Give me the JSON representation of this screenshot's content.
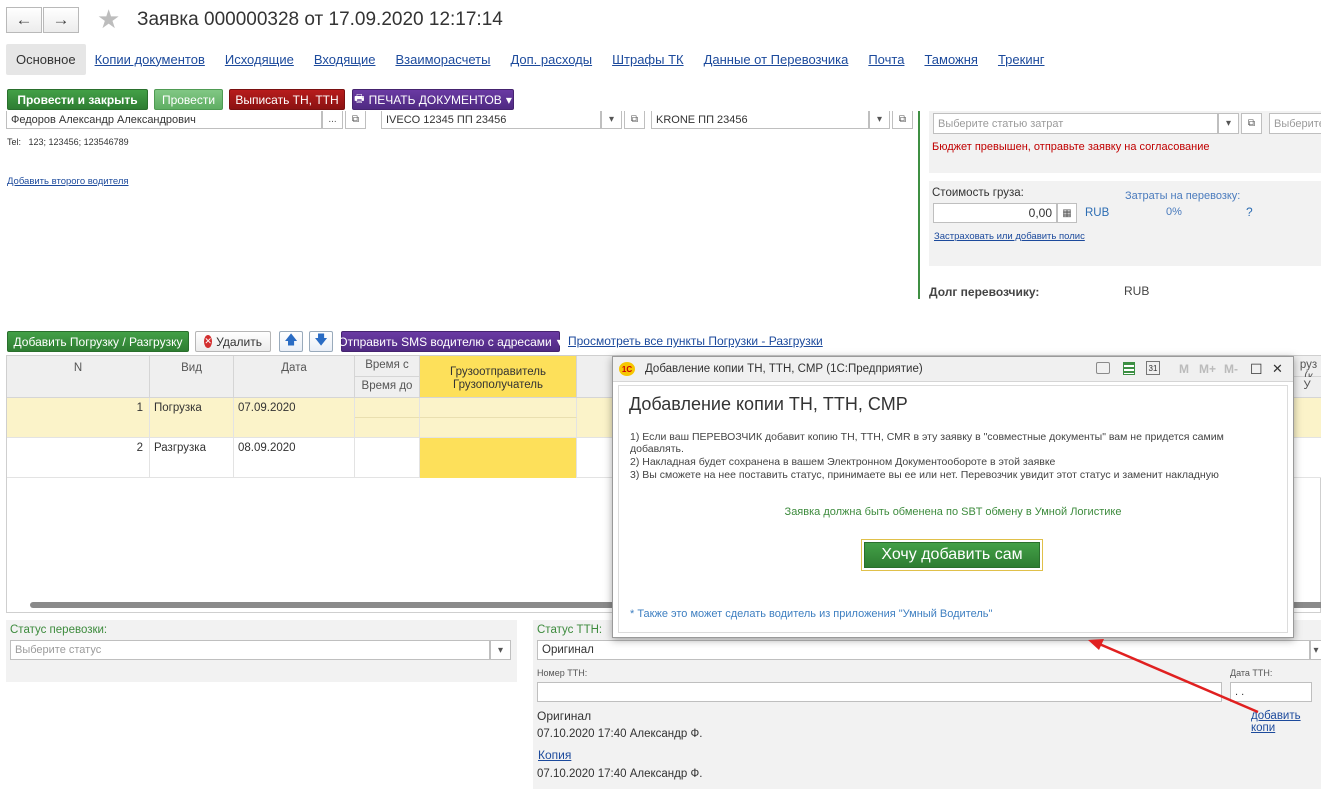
{
  "header": {
    "back_glyph": "←",
    "forward_glyph": "→",
    "star_glyph": "★",
    "title": "Заявка 000000328 от 17.09.2020 12:17:14"
  },
  "tabs": [
    {
      "label": "Основное"
    },
    {
      "label": "Копии документов"
    },
    {
      "label": "Исходящие"
    },
    {
      "label": "Входящие"
    },
    {
      "label": "Взаиморасчеты"
    },
    {
      "label": "Доп. расходы"
    },
    {
      "label": "Штрафы ТК"
    },
    {
      "label": "Данные от Перевозчика"
    },
    {
      "label": "Почта"
    },
    {
      "label": "Таможня"
    },
    {
      "label": "Трекинг"
    }
  ],
  "toolbar": {
    "post_close": "Провести и закрыть",
    "post": "Провести",
    "issue_tn": "Выписать ТН, ТТН",
    "print_docs": "ПЕЧАТЬ ДОКУМЕНТОВ",
    "print_glyph": "🖶",
    "dropdown_glyph": "▾"
  },
  "driver": {
    "name": "Федоров Александр Александрович",
    "tel_label": "Tel:",
    "tel": "123; 123456; 123546789",
    "add_second": "Добавить второго водителя",
    "truck": "IVECO 12345 ПП 23456",
    "trailer": "KRONE ПП 23456",
    "dots": "...",
    "open_glyph": "⧉",
    "down_glyph": "▾"
  },
  "cost": {
    "article_placeholder": "Выберите статью затрат",
    "article2_placeholder": "Выберите",
    "budget_warning": "Бюджет превышен, отправьте заявку на согласование",
    "cargo_cost_label": "Стоимость груза:",
    "cargo_cost_value": "0,00",
    "currency": "RUB",
    "transport_cost_label": "Затраты на перевозку:",
    "transport_cost_value": "0%",
    "question": "?",
    "insure_link": "Застраховать или добавить полис",
    "debt_label": "Долг перевозчику:",
    "debt_currency": "RUB",
    "calc_glyph": "▦"
  },
  "points_toolbar": {
    "add_load": "Добавить Погрузку / Разгрузку",
    "delete": "Удалить",
    "delete_glyph": "✕",
    "up_glyph": "🡅",
    "down_glyph": "🡇",
    "send_sms": "Отправить SMS водителю с адресами",
    "view_all": "Просмотреть все пункты Погрузки - Разгрузки"
  },
  "table": {
    "headers": {
      "n": "N",
      "kind": "Вид",
      "date": "Дата",
      "time_from": "Время с",
      "time_to": "Время до",
      "shipper": "Грузоотправитель",
      "consignee": "Грузополучатель",
      "cargo_right": "руз (к",
      "cargo_right2": "У"
    },
    "rows": [
      {
        "n": "1",
        "kind": "Погрузка",
        "date": "07.09.2020"
      },
      {
        "n": "2",
        "kind": "Разгрузка",
        "date": "08.09.2020"
      }
    ]
  },
  "status": {
    "transport_label": "Статус перевозки:",
    "transport_placeholder": "Выберите статус",
    "ttn_label": "Статус ТТН:",
    "ttn_value": "Оригинал",
    "ttn_number_label": "Номер ТТН:",
    "ttn_date_label": "Дата ТТН:",
    "ttn_date_value": " .  .",
    "original_label": "Оригинал",
    "original_stamp": "07.10.2020 17:40 Александр Ф.",
    "copy_link": "Копия",
    "copy_stamp": "07.10.2020 17:40 Александр Ф.",
    "add_copy_link": "добавить копи",
    "down_glyph": "▾"
  },
  "dialog": {
    "app_icon": "1С",
    "window_title": "Добавление копии ТН, ТТН, СМР  (1С:Предприятие)",
    "ctrl_m": "M",
    "ctrl_mplus": "M+",
    "ctrl_mminus": "M-",
    "ctrl_max": "☐",
    "ctrl_close": "✕",
    "ctrl_cal": "31",
    "heading": "Добавление копии ТН, ТТН, СМР",
    "line1": "1) Если ваш ПЕРЕВОЗЧИК добавит копию ТН, ТТН, CMR в эту заявку в \"совместные документы\" вам не придется самим добавлять.",
    "line2": "2) Накладная будет сохранена в вашем Электронном Документообороте в этой заявке",
    "line3": "3) Вы сможете на нее поставить статус, принимаете вы ее или нет. Перевозчик увидит этот статус и заменит накладную",
    "sbt_note": "Заявка должна быть обменена по SBT обмену в Умной Логистике",
    "add_self_button": "Хочу добавить сам",
    "footnote": "* Также это может сделать водитель из приложения \"Умный Водитель\""
  },
  "colors": {
    "accent_green": "#2e7d32",
    "warning_red": "#c00000",
    "highlight_yellow": "#fde05a",
    "row_selected": "#fbf3c9",
    "arrow_red": "#e02020"
  }
}
